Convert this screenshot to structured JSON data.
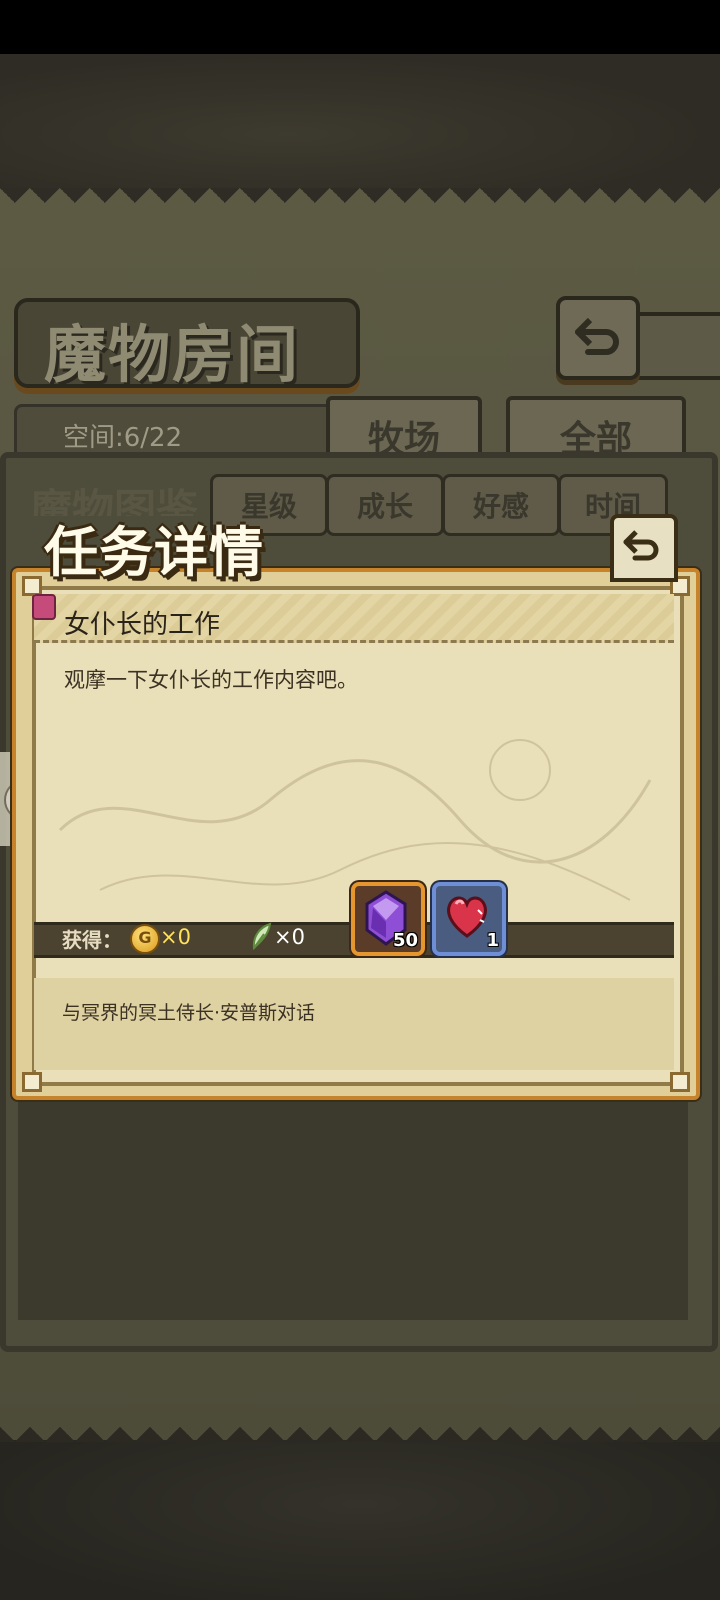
{
  "background_screen": {
    "title": "魔物房间",
    "space_label": "空间:6/22",
    "tabs": [
      {
        "label": "牧场"
      },
      {
        "label": "全部"
      }
    ],
    "section_title": "魔物图鉴",
    "filters": [
      {
        "label": "星级"
      },
      {
        "label": "成长"
      },
      {
        "label": "好感"
      },
      {
        "label": "时间"
      }
    ]
  },
  "dialog": {
    "title": "任务详情",
    "quest_name": "女仆长的工作",
    "description": "观摩一下女仆长的工作内容吧。",
    "rewards": {
      "label": "获得：",
      "coin_symbol": "G",
      "coin_amount": "×0",
      "feather_amount": "×0",
      "items": [
        {
          "icon": "purple-crystal-icon",
          "quantity": "50"
        },
        {
          "icon": "red-heart-shard-icon",
          "quantity": "1"
        }
      ]
    },
    "objective": "与冥界的冥土侍长·安普斯对话"
  },
  "colors": {
    "dialog_border": "#c7832c",
    "parchment": "#e9dfb8",
    "coin_text": "#ffe25a"
  }
}
